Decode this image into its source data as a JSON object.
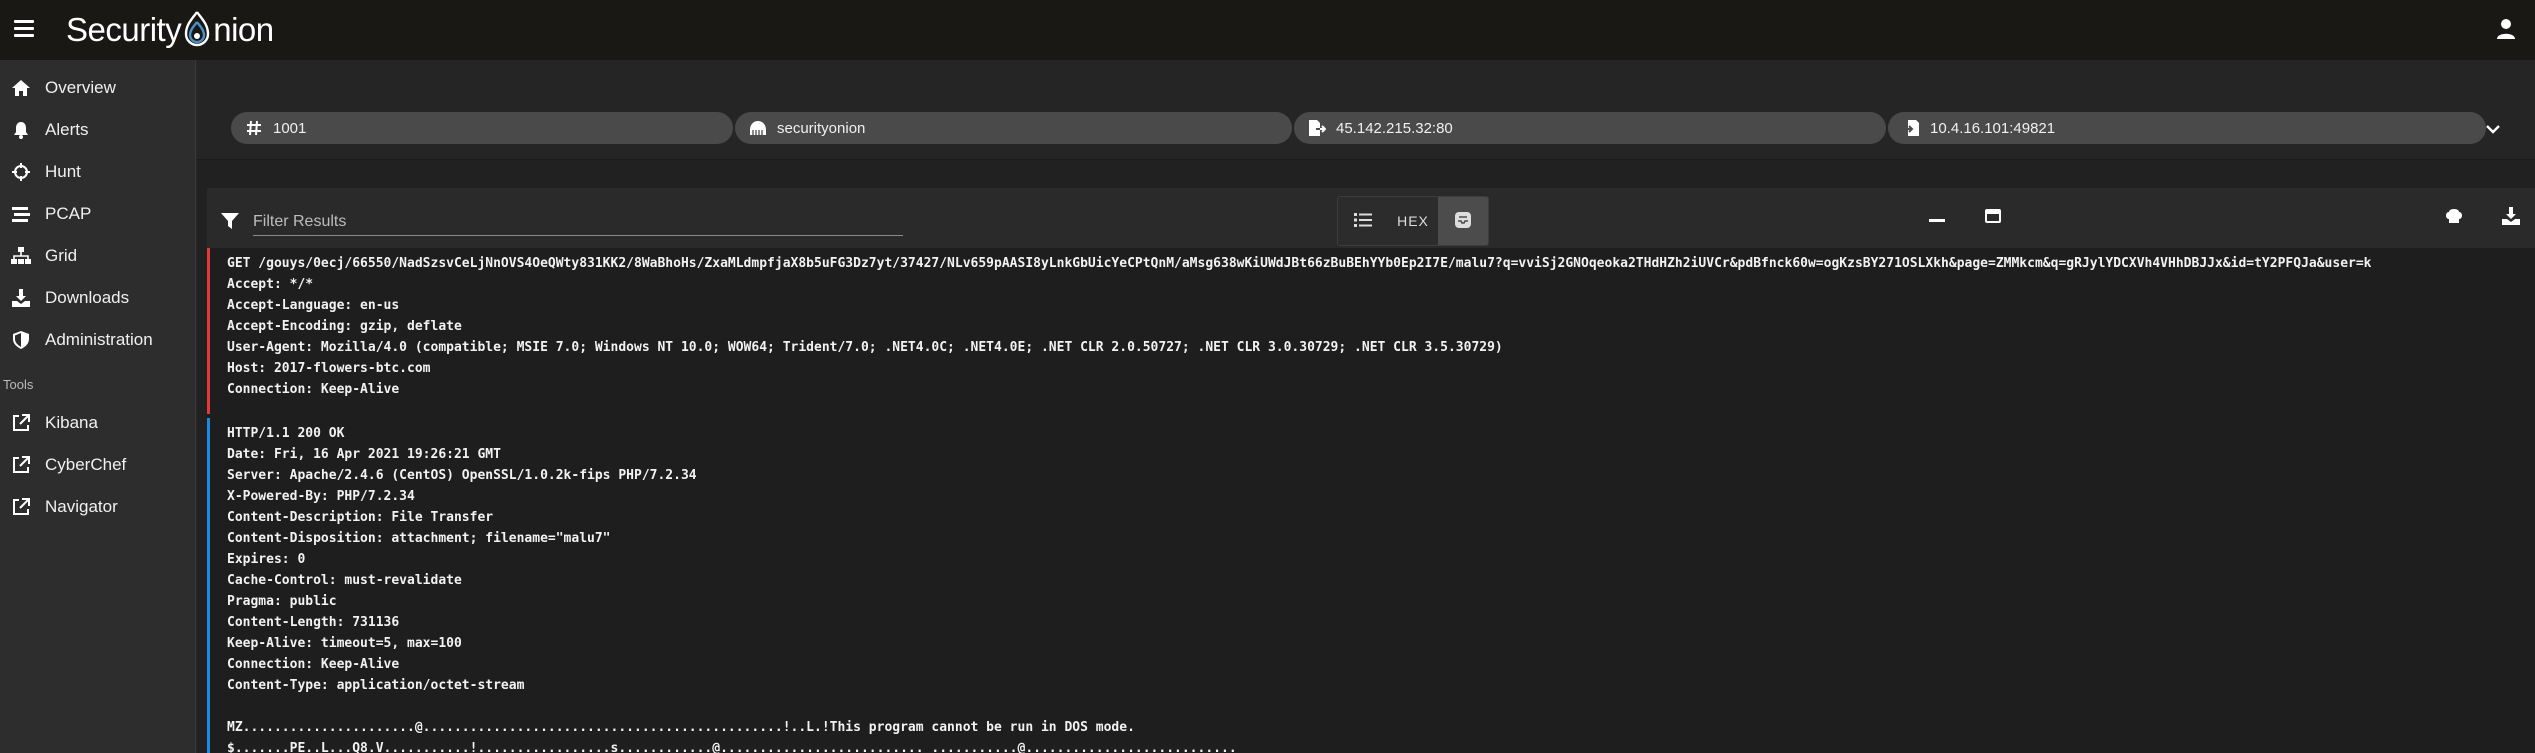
{
  "app": {
    "logo_text_left": "Security",
    "logo_text_right": "nion"
  },
  "sidebar": {
    "items": [
      {
        "label": "Overview",
        "icon": "home-icon"
      },
      {
        "label": "Alerts",
        "icon": "bell-icon"
      },
      {
        "label": "Hunt",
        "icon": "crosshairs-icon"
      },
      {
        "label": "PCAP",
        "icon": "stream-icon"
      },
      {
        "label": "Grid",
        "icon": "sitemap-icon"
      },
      {
        "label": "Downloads",
        "icon": "download-icon"
      },
      {
        "label": "Administration",
        "icon": "shield-icon"
      }
    ],
    "tools_header": "Tools",
    "tools": [
      {
        "label": "Kibana",
        "icon": "external-link-icon"
      },
      {
        "label": "CyberChef",
        "icon": "external-link-icon"
      },
      {
        "label": "Navigator",
        "icon": "external-link-icon"
      }
    ]
  },
  "job": {
    "id": "1001",
    "sensor": "securityonion",
    "source": "45.142.215.32:80",
    "destination": "10.4.16.101:49821"
  },
  "toolbar": {
    "filter_placeholder": "Filter Results",
    "hex_label": "HEX"
  },
  "client_stream": [
    "GET /gouys/0ecj/66550/NadSzsvCeLjNnOVS4OeQWty831KK2/8WaBhoHs/ZxaMLdmpfjaX8b5uFG3Dz7yt/37427/NLv659pAASI8yLnkGbUicYeCPtQnM/aMsg638wKiUWdJBt66zBuBEhYYb0Ep2I7E/malu7?q=vviSj2GNOqeoka2THdHZh2iUVCr&pdBfnck60w=ogKzsBY271OSLXkh&page=ZMMkcm&q=gRJylYDCXVh4VHhDBJJx&id=tY2PFQJa&user=k",
    "Accept: */*",
    "Accept-Language: en-us",
    "Accept-Encoding: gzip, deflate",
    "User-Agent: Mozilla/4.0 (compatible; MSIE 7.0; Windows NT 10.0; WOW64; Trident/7.0; .NET4.0C; .NET4.0E; .NET CLR 2.0.50727; .NET CLR 3.0.30729; .NET CLR 3.5.30729)",
    "Host: 2017-flowers-btc.com",
    "Connection: Keep-Alive"
  ],
  "server_stream": [
    "HTTP/1.1 200 OK",
    "Date: Fri, 16 Apr 2021 19:26:21 GMT",
    "Server: Apache/2.4.6 (CentOS) OpenSSL/1.0.2k-fips PHP/7.2.34",
    "X-Powered-By: PHP/7.2.34",
    "Content-Description: File Transfer",
    "Content-Disposition: attachment; filename=\"malu7\"",
    "Expires: 0",
    "Cache-Control: must-revalidate",
    "Pragma: public",
    "Content-Length: 731136",
    "Keep-Alive: timeout=5, max=100",
    "Connection: Keep-Alive",
    "Content-Type: application/octet-stream",
    "",
    "MZ......................@..............................................!..L.!This program cannot be run in DOS mode.",
    "$.......PE..L...Q8.V...........!.................s............@.......................... ...........@..........................."
  ],
  "colors": {
    "client_border": "#e53935",
    "server_border": "#1e88e5",
    "logo_accent": "#4a90c8"
  }
}
